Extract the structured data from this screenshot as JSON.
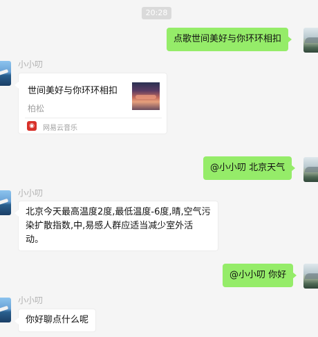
{
  "timestamp": "20:28",
  "messages": {
    "m1": "点歌世间美好与你环环相扣",
    "m2_sender": "小小叨",
    "m2_card": {
      "title": "世间美好与你环环相扣",
      "artist": "柏松",
      "source": "网易云音乐",
      "source_icon": "netease-cloud-music-icon",
      "source_color": "#d8312a"
    },
    "m3": "@小小叨 北京天气",
    "m4_sender": "小小叨",
    "m4": "北京今天最高温度2度,最低温度-6度,晴,空气污染扩散指数,中,易感人群应适当减少室外活动。",
    "m5": "@小小叨 你好",
    "m6_sender": "小小叨",
    "m6": "你好聊点什么呢"
  },
  "colors": {
    "own_bubble": "#95ec69",
    "other_bubble": "#ffffff",
    "background": "#f5f5f5"
  }
}
